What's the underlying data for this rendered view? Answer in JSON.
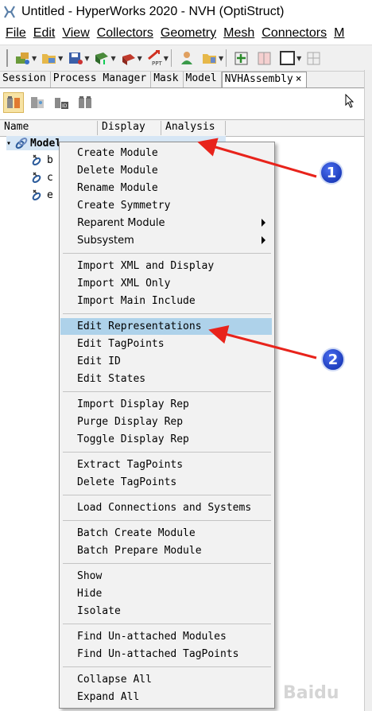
{
  "window": {
    "title": "Untitled - HyperWorks 2020 - NVH (OptiStruct)"
  },
  "menubar": [
    {
      "label": "File"
    },
    {
      "label": "Edit"
    },
    {
      "label": "View"
    },
    {
      "label": "Collectors"
    },
    {
      "label": "Geometry"
    },
    {
      "label": "Mesh"
    },
    {
      "label": "Connectors"
    },
    {
      "label": "M"
    }
  ],
  "toolbar": {
    "ppt_label": "PPT"
  },
  "tabs": [
    {
      "label": "Session"
    },
    {
      "label": "Process Manager"
    },
    {
      "label": "Mask"
    },
    {
      "label": "Model"
    },
    {
      "label": "NVHAssembly"
    }
  ],
  "tab_close": "×",
  "tree": {
    "columns": [
      "Name",
      "Display",
      "Analysis"
    ],
    "root": {
      "label": "Model",
      "expander": "▾"
    },
    "children": [
      "b",
      "c",
      "e"
    ]
  },
  "context_menu": {
    "items": [
      {
        "label": "Create Module"
      },
      {
        "label": "Delete Module"
      },
      {
        "label": "Rename Module"
      },
      {
        "label": "Create Symmetry"
      },
      {
        "label": "Reparent Module"
      },
      {
        "label": "Subsystem"
      },
      {
        "label": "Import XML and Display"
      },
      {
        "label": "Import XML Only"
      },
      {
        "label": "Import Main Include"
      },
      {
        "label": "Edit Representations"
      },
      {
        "label": "Edit TagPoints"
      },
      {
        "label": "Edit ID"
      },
      {
        "label": "Edit States"
      },
      {
        "label": "Import Display Rep"
      },
      {
        "label": "Purge Display Rep"
      },
      {
        "label": "Toggle Display Rep"
      },
      {
        "label": "Extract TagPoints"
      },
      {
        "label": "Delete TagPoints"
      },
      {
        "label": "Load Connections and Systems"
      },
      {
        "label": "Batch Create Module"
      },
      {
        "label": "Batch Prepare Module"
      },
      {
        "label": "Show"
      },
      {
        "label": "Hide"
      },
      {
        "label": "Isolate"
      },
      {
        "label": "Find Un-attached Modules"
      },
      {
        "label": "Find Un-attached TagPoints"
      },
      {
        "label": "Collapse All"
      },
      {
        "label": "Expand All"
      }
    ],
    "highlighted": "Edit Representations"
  },
  "annotations": {
    "badge1": "1",
    "badge2": "2"
  },
  "colors": {
    "arrow": "#e8231b",
    "badge": "#1a3fd0",
    "highlight": "#aed2ea"
  },
  "watermark": {
    "text": "Baidu"
  }
}
